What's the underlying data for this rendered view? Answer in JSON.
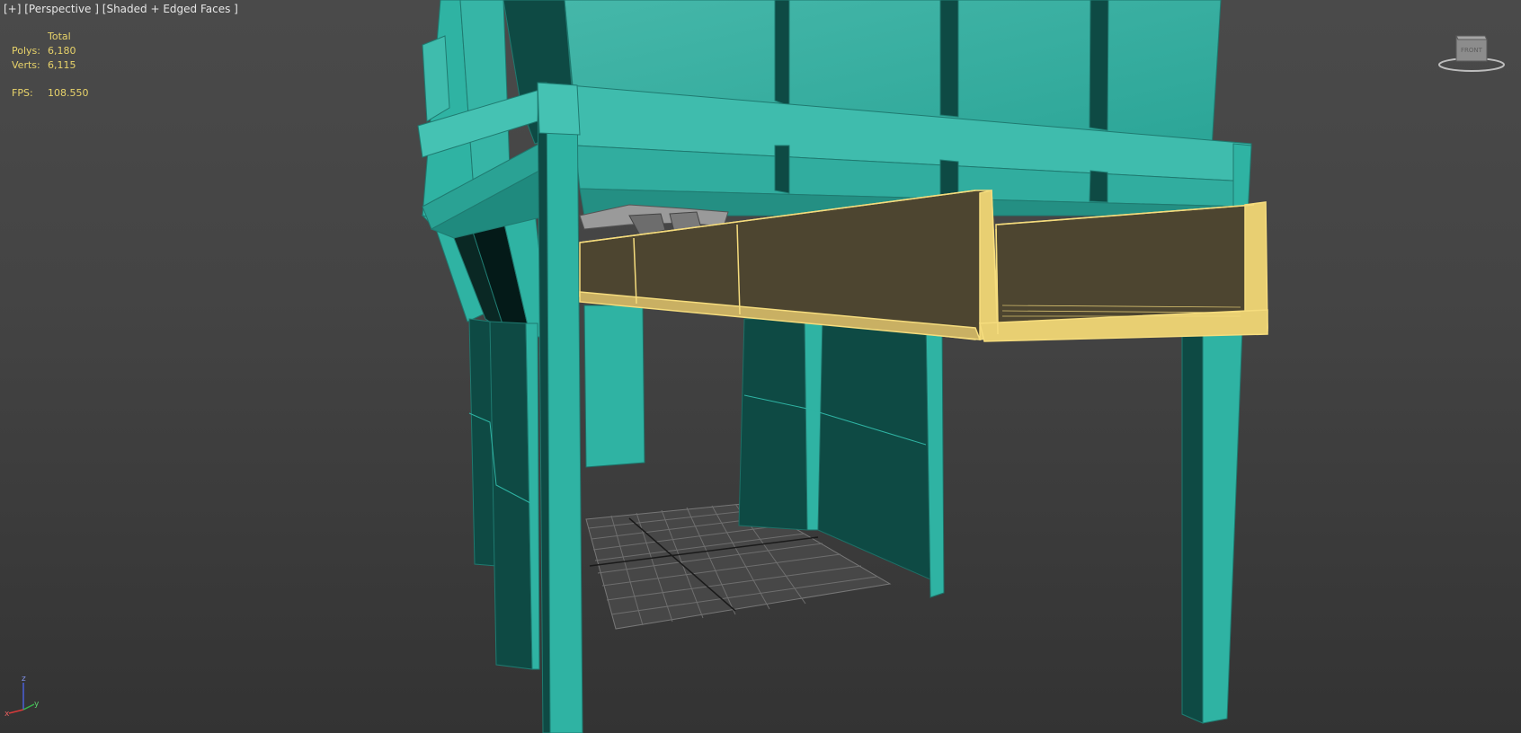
{
  "viewport": {
    "menu_plus": "[+]",
    "view_name": "[Perspective ]",
    "shading_mode": "[Shaded + Edged Faces ]"
  },
  "stats": {
    "header": "Total",
    "polys_label": "Polys:",
    "polys_value": "6,180",
    "verts_label": "Verts:",
    "verts_value": "6,115",
    "fps_label": "FPS:",
    "fps_value": "108.550"
  },
  "viewcube": {
    "face_label": "FRONT"
  },
  "axis_gizmo": {
    "z": "z",
    "x": "x",
    "y": "y"
  },
  "colors": {
    "background": "#444444",
    "mesh_teal": "#2fb3a3",
    "mesh_teal_dark": "#0d4a44",
    "selection_yellow": "#f0d77a",
    "selection_fill": "#4d4530",
    "stats_text": "#e8d36a",
    "grid": "#707070"
  }
}
